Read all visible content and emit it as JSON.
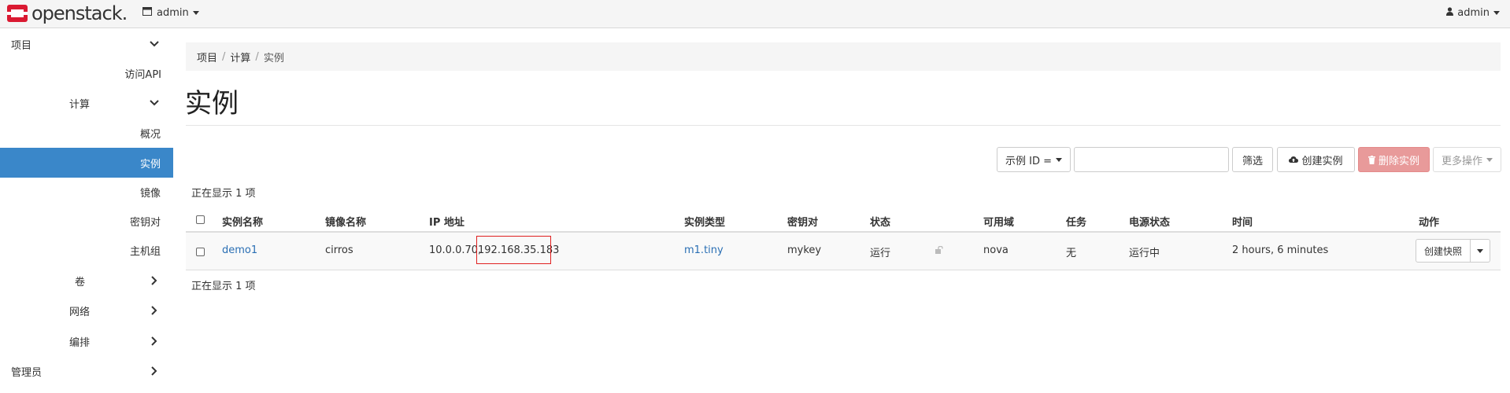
{
  "topbar": {
    "brand": "openstack.",
    "project_menu": "admin",
    "user_menu": "admin"
  },
  "sidebar": {
    "items": [
      {
        "label": "项目"
      },
      {
        "label": "访问API"
      },
      {
        "label": "计算"
      },
      {
        "label": "概况"
      },
      {
        "label": "实例"
      },
      {
        "label": "镜像"
      },
      {
        "label": "密钥对"
      },
      {
        "label": "主机组"
      },
      {
        "label": "卷"
      },
      {
        "label": "网络"
      },
      {
        "label": "编排"
      },
      {
        "label": "管理员"
      }
    ]
  },
  "breadcrumb": [
    "项目",
    "计算",
    "实例"
  ],
  "breadcrumb_sep": "/",
  "page_title": "实例",
  "toolbar": {
    "filter_field": "示例 ID =",
    "filter_value": "",
    "filter_label": "筛选",
    "create_label": "创建实例",
    "delete_label": "删除实例",
    "more_label": "更多操作"
  },
  "count_top": "正在显示 1 项",
  "count_bottom": "正在显示 1 项",
  "table": {
    "columns": [
      "实例名称",
      "镜像名称",
      "IP 地址",
      "实例类型",
      "密钥对",
      "状态",
      "可用域",
      "任务",
      "电源状态",
      "时间",
      "动作"
    ],
    "rows": [
      {
        "name": "demo1",
        "image": "cirros",
        "ip_internal": "10.0.0.70,",
        "ip_floating": "192.168.35.183",
        "flavor": "m1.tiny",
        "keypair": "mykey",
        "status": "运行",
        "zone": "nova",
        "task": "无",
        "power": "运行中",
        "age": "2 hours, 6 minutes",
        "action": "创建快照"
      }
    ]
  },
  "colors": {
    "accent": "#3a87c9",
    "danger_button": "#e89a9a",
    "highlight_box": "#e02020",
    "brand_red": "#da1a32"
  }
}
